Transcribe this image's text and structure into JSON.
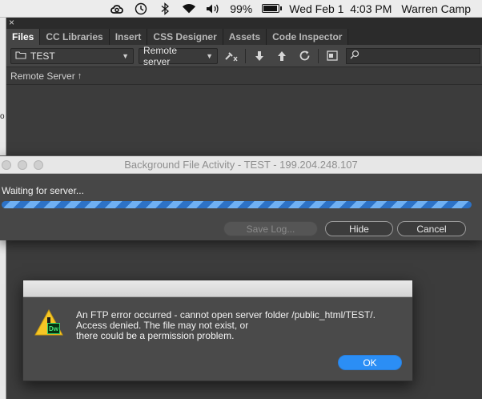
{
  "menubar": {
    "battery_percent": "99%",
    "battery_level": 0.99,
    "datetime": "Wed Feb 1  4:03 PM",
    "user": "Warren Camp",
    "icons": [
      "creative-cloud-icon",
      "time-machine-icon",
      "bluetooth-icon",
      "wifi-icon",
      "volume-icon",
      "battery-icon"
    ]
  },
  "panel": {
    "close_glyph": "×",
    "tabs": [
      {
        "label": "Files",
        "active": true
      },
      {
        "label": "CC Libraries",
        "active": false
      },
      {
        "label": "Insert",
        "active": false
      },
      {
        "label": "CSS Designer",
        "active": false
      },
      {
        "label": "Assets",
        "active": false
      },
      {
        "label": "Code Inspector",
        "active": false
      }
    ],
    "site_select": "TEST",
    "view_select": "Remote server",
    "column_header": "Remote Server",
    "sort_glyph": "↑"
  },
  "bfa": {
    "title": "Background File Activity - TEST - 199.204.248.107",
    "status": "Waiting for server...",
    "save_log": "Save Log...",
    "hide": "Hide",
    "cancel": "Cancel"
  },
  "error": {
    "badge": "Dw",
    "line1": "An FTP error occurred - cannot open server folder /public_html/TEST/.",
    "line2": "Access denied.  The file may not exist, or",
    "line3": "there could be a permission problem.",
    "ok": "OK"
  },
  "colors": {
    "accent": "#2b8ef5",
    "panel_bg": "#3c3c3c",
    "progress_light": "#6fb0f3",
    "warning_yellow": "#f6c625"
  }
}
